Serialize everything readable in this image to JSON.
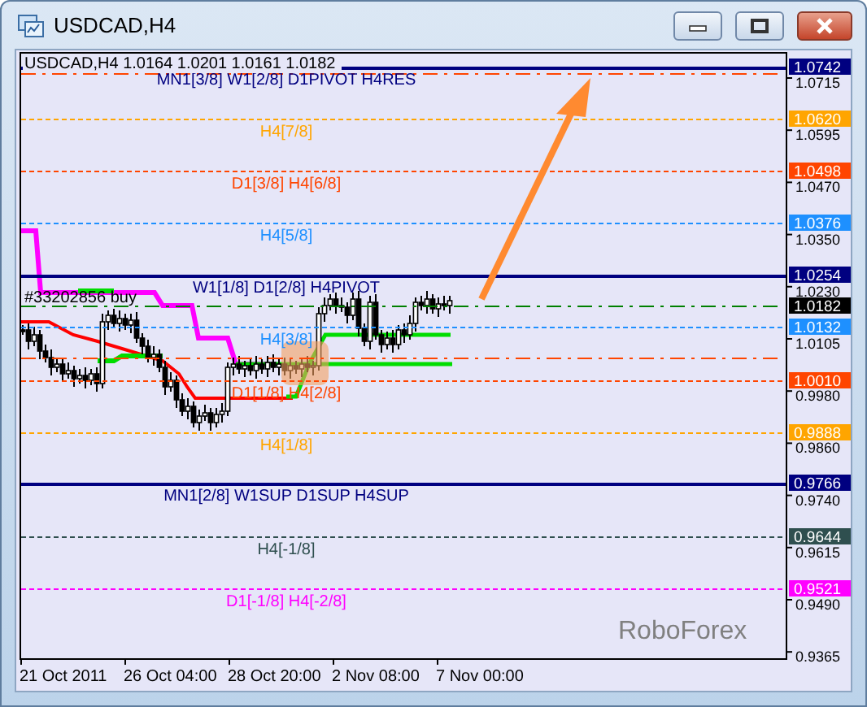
{
  "window": {
    "title": "USDCAD,H4"
  },
  "chart": {
    "bid": "1.0182",
    "header": "USDCAD,H4  1.0164 1.0201 1.0161 1.0182",
    "order_label": "#33202856 buy",
    "watermark": "RoboForex",
    "levels": [
      {
        "kind": "solid",
        "color": "#000080",
        "label": "MN1[3/8] W1[2/8] D1PIVOT H4RES",
        "price": "1.0742"
      },
      {
        "kind": "dashdot",
        "color": "#ff4500"
      },
      {
        "kind": "dotted",
        "color": "#ffa500",
        "label": "H4[7/8]",
        "price": "1.0620"
      },
      {
        "kind": "dotted",
        "color": "#ff4500",
        "label": "D1[3/8] H4[6/8]",
        "price": "1.0498"
      },
      {
        "kind": "dotted",
        "color": "#1e90ff",
        "label": "H4[5/8]",
        "price": "1.0376"
      },
      {
        "kind": "solid",
        "color": "#000080",
        "label": "W1[1/8] D1[2/8] H4PIVOT",
        "price": "1.0254"
      },
      {
        "kind": "dashdot",
        "color": "#008000"
      },
      {
        "kind": "dotted",
        "color": "#1e90ff",
        "label": "H4[3/8]",
        "price": "1.0132"
      },
      {
        "kind": "dashdot",
        "color": "#ff4500"
      },
      {
        "kind": "dotted",
        "color": "#ff4500",
        "label": "D1[1/8] H4[2/8]",
        "price": "1.0010"
      },
      {
        "kind": "dotted",
        "color": "#ffa500",
        "label": "H4[1/8]",
        "price": "0.9888"
      },
      {
        "kind": "solid",
        "color": "#000080",
        "label": "MN1[2/8] W1SUP D1SUP H4SUP",
        "price": "0.9766"
      },
      {
        "kind": "dotted",
        "color": "#2f4f4f",
        "label": "H4[-1/8]",
        "price": "0.9644"
      },
      {
        "kind": "dotted",
        "color": "#ff00ff",
        "label": "D1[-1/8] H4[-2/8]",
        "price": "0.9521"
      }
    ],
    "y_ticks": [
      "1.0715",
      "1.0595",
      "1.0470",
      "1.0350",
      "1.0230",
      "1.0105",
      "0.9980",
      "0.9860",
      "0.9740",
      "0.9615",
      "0.9490",
      "0.9365"
    ],
    "x_ticks": [
      "21 Oct 2011",
      "26 Oct 04:00",
      "28 Oct 20:00",
      "2 Nov 08:00",
      "7 Nov 00:00"
    ]
  }
}
